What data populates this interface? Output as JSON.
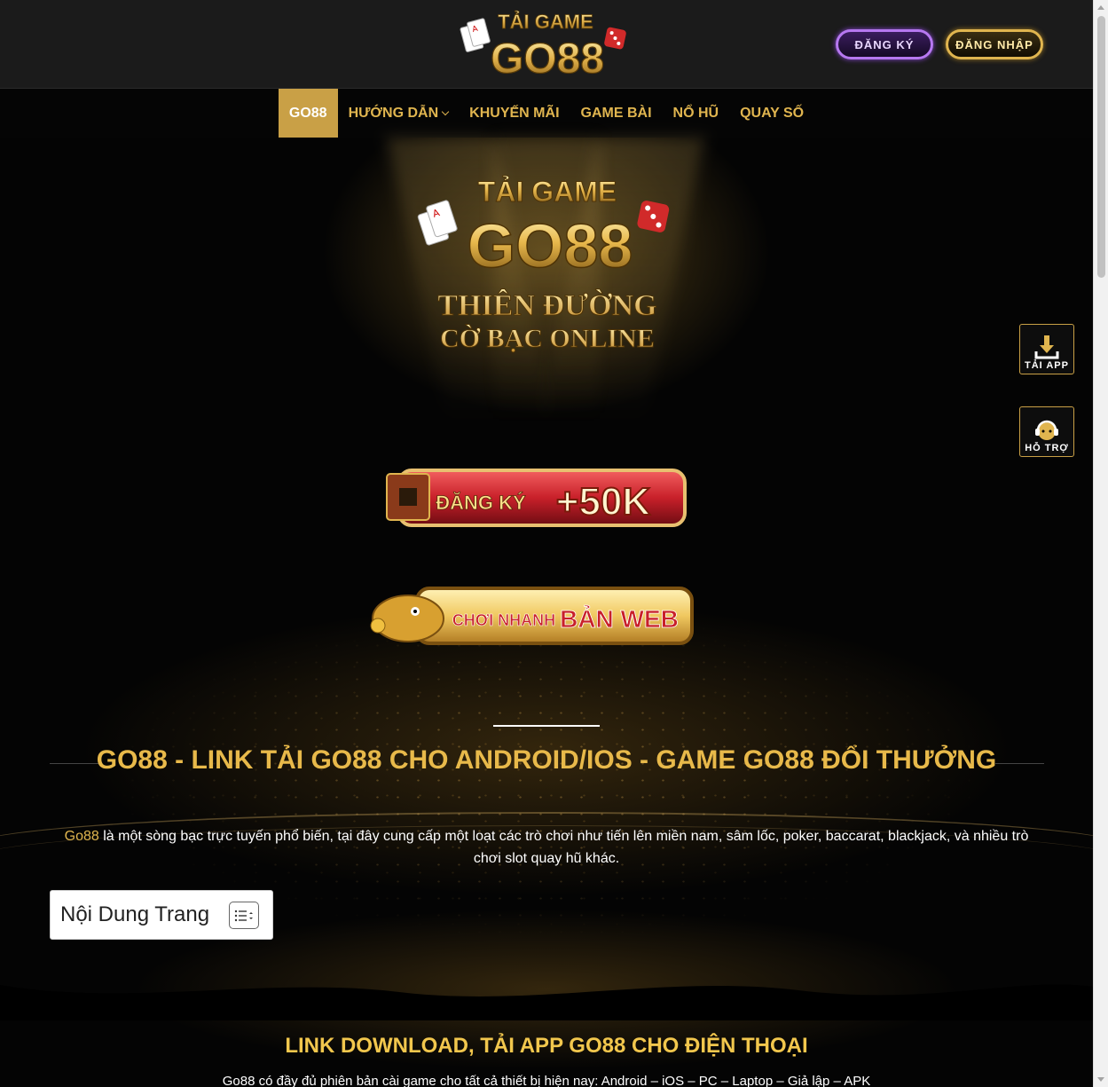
{
  "header": {
    "logo_line1": "TẢI GAME",
    "logo_line2": "GO88",
    "register_label": "ĐĂNG KÝ",
    "login_label": "ĐĂNG NHẬP"
  },
  "nav": {
    "items": [
      {
        "label": "GO88"
      },
      {
        "label": "HƯỚNG DẪN"
      },
      {
        "label": "KHUYẾN MÃI"
      },
      {
        "label": "GAME BÀI"
      },
      {
        "label": "NỔ HŨ"
      },
      {
        "label": "QUAY SỐ"
      }
    ]
  },
  "hero": {
    "logo_line1": "TẢI GAME",
    "logo_line2": "GO88",
    "tagline_1": "THIÊN ĐƯỜNG",
    "tagline_2": "CỜ BẠC ONLINE",
    "banner_register_text": "ĐĂNG KÝ",
    "banner_register_bonus": "+50K",
    "banner_web_text_1": "CHƠI NHANH",
    "banner_web_text_2": "BẢN WEB"
  },
  "side": {
    "app_label": "TẢI APP",
    "help_label": "HỖ TRỢ"
  },
  "content": {
    "h1": "GO88 - LINK TẢI GO88 CHO ANDROID/IOS - GAME GO88 ĐỔI THƯỞNG",
    "intro_link": "Go88",
    "intro_text": " là một sòng bạc trực tuyến phổ biến, tại đây cung cấp một loạt các trò chơi như tiến lên miền nam, sâm lốc, poker, baccarat, blackjack, và nhiều trò chơi slot quay hũ khác.",
    "toc_title": "Nội Dung Trang",
    "h2": "LINK DOWNLOAD, TẢI APP GO88 CHO ĐIỆN THOẠI",
    "p2": "Go88 có đầy đủ phiên bản cài game cho tất cả thiết bị hiện nay: Android – iOS – PC – Laptop – Giả lập – APK"
  },
  "colors": {
    "gold": "#e0b54f",
    "nav_active": "#c9a046",
    "register_purple": "#b678f0",
    "banner_red": "#c8202a"
  }
}
